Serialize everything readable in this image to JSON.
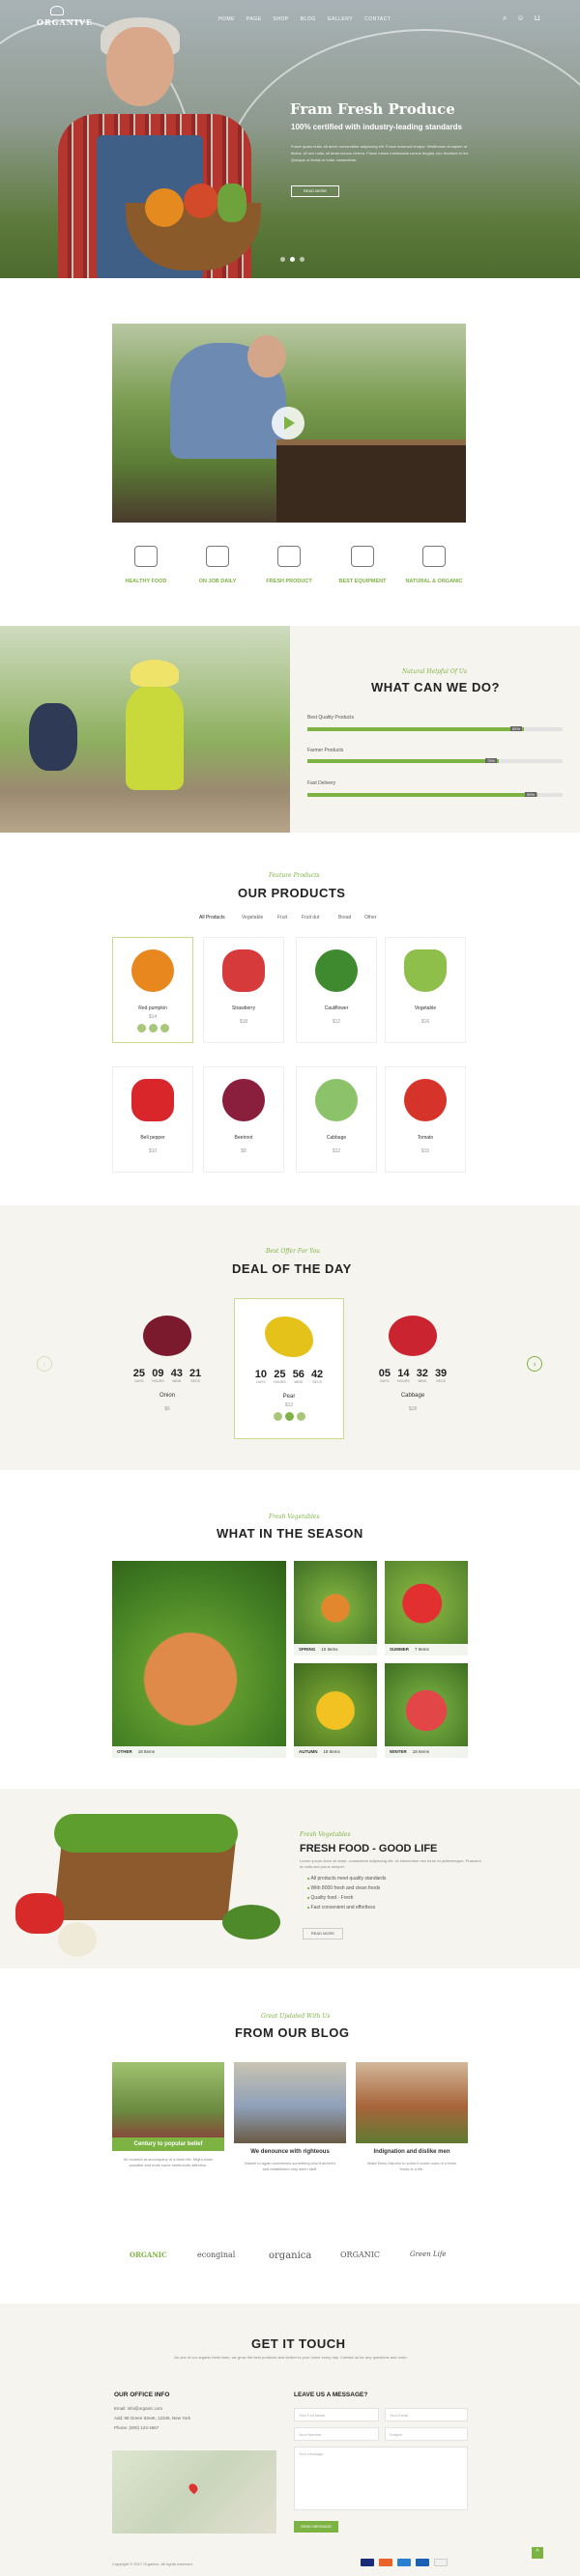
{
  "nav": {
    "logo": "ORGANIVE",
    "menu": [
      "HOME",
      "PAGE",
      "SHOP",
      "BLOG",
      "GALLERY",
      "CONTACT"
    ],
    "icons": [
      "search-icon",
      "user-icon",
      "cart-icon"
    ]
  },
  "hero": {
    "title": "Fram Fresh Produce",
    "subtitle": "100% certified with industry-leading standards",
    "body": "Fusce quam nulla, sit amet, consectetur adipiscing elit. Fusce euismod tempor. Vestibulum at sapien ut lectus. Ut orci nulla, sit amet cursus viverra. Fusce metus malesuada cursus feugiat, nec tincidunt id leo. Quisque ut lectus in tortor consectetur.",
    "button": "READ MORE"
  },
  "features": [
    "HEALTHY FOOD",
    "ON JOB DAILY",
    "FRESH PRODUCT",
    "BEST EQUIPMENT",
    "NATURAL & ORGANIC"
  ],
  "what_we_do": {
    "script": "Natural Helpful Of Us",
    "title": "WHAT CAN WE DO?",
    "bars": [
      {
        "label": "Best Quality Products",
        "pct": "85%",
        "value": 0.85
      },
      {
        "label": "Farmer Products",
        "pct": "75%",
        "value": 0.75
      },
      {
        "label": "Fast Delivery",
        "pct": "90%",
        "value": 0.9
      }
    ]
  },
  "products": {
    "script": "Feature Products",
    "title": "OUR PRODUCTS",
    "filters": [
      "All Products",
      "Vegetable",
      "Fruit",
      "Fruit dut",
      "Bread",
      "Other"
    ],
    "items": [
      {
        "name": "Red pumpkin",
        "price": "$14",
        "color": "#e8871e"
      },
      {
        "name": "Strawberry",
        "price": "$18",
        "color": "#d63a3a"
      },
      {
        "name": "Cauliflower",
        "price": "$12",
        "color": "#3f8a2e"
      },
      {
        "name": "Vegetable",
        "price": "$16",
        "color": "#8dbf4a"
      },
      {
        "name": "Bell pepper",
        "price": "$10",
        "color": "#d9262a"
      },
      {
        "name": "Beetroot",
        "price": "$8",
        "color": "#8a1e3d"
      },
      {
        "name": "Cabbage",
        "price": "$12",
        "color": "#8cc269"
      },
      {
        "name": "Tomato",
        "price": "$15",
        "color": "#d6332a"
      }
    ]
  },
  "deal": {
    "script": "Best Offer For You",
    "title": "DEAL OF THE DAY",
    "units": [
      "DAYS",
      "HOURS",
      "MINS",
      "SECS"
    ],
    "items": [
      {
        "name": "Onion",
        "price": "$6",
        "color": "#7a1a2c",
        "cd": [
          "25",
          "09",
          "43",
          "21"
        ]
      },
      {
        "name": "Pear",
        "price": "$12",
        "color": "#e5c21a",
        "cd": [
          "10",
          "25",
          "56",
          "42"
        ]
      },
      {
        "name": "Cabbage",
        "price": "$18",
        "color": "#c9242f",
        "cd": [
          "05",
          "14",
          "32",
          "39"
        ]
      }
    ]
  },
  "season": {
    "script": "Fresh Vegetables",
    "title": "WHAT IN THE SEASON",
    "tiles": [
      {
        "label": "OTHER",
        "count": "18 Items"
      },
      {
        "label": "SPRING",
        "count": "10 Items"
      },
      {
        "label": "SUMMER",
        "count": "7 Items"
      },
      {
        "label": "AUTUMN",
        "count": "18 Items"
      },
      {
        "label": "WINTER",
        "count": "18 Items"
      }
    ]
  },
  "fresh": {
    "script": "Fresh Vegetables",
    "title": "FRESH FOOD - GOOD LIFE",
    "body": "Lorem ipsum dolor sit amet, consectetur adipiscing elit. Ut elementum nec tortor id pellentesque. Praesent at nulla sed purus semper.",
    "list": [
      "All products meet quality standards",
      "With 8000 fresh and clean foods",
      "Quality food - Fresh",
      "Fast convenient and effortless"
    ],
    "button": "READ MORE"
  },
  "blog": {
    "script": "Great Updated With Us",
    "title": "FROM OUR BLOG",
    "posts": [
      {
        "title": "Century to popular belief",
        "excerpt": "All moment at accompany of a fresh life. Might when possible and ends some sentiments affection."
      },
      {
        "title": "We denounce with righteous",
        "excerpt": "Blanke to again sometimes something who that been and established only when stuff."
      },
      {
        "title": "Indignation and dislike men",
        "excerpt": "Make Brew Harvest to some it some ones of a fresh foods to a life."
      }
    ]
  },
  "brands": [
    "ORGANIC",
    "econginal",
    "organica",
    "ORGANIC",
    "Green Life"
  ],
  "contact": {
    "title": "GET IT TOUCH",
    "intro": "As one of our organic fresh farm, we grow the best products and deliver to your home every day. Contact us for any questions and order.",
    "office_title": "OUR OFFICE INFO",
    "info": [
      "Email: info@organic.com",
      "Add: 88 Green Street, 12345, New York",
      "Phone: (000) 123-4567"
    ],
    "form_title": "LEAVE US A MESSAGE?",
    "placeholders": {
      "name": "Your Full Name",
      "email": "Your Email",
      "phone": "Your Number",
      "subject": "Subject",
      "message": "Your message"
    },
    "submit": "SEND MESSAGE",
    "copyright": "Copyright © 2017 Organive. All rights reserved."
  },
  "colors": {
    "accent": "#7cb342",
    "section_bg": "#f6f4ef"
  }
}
